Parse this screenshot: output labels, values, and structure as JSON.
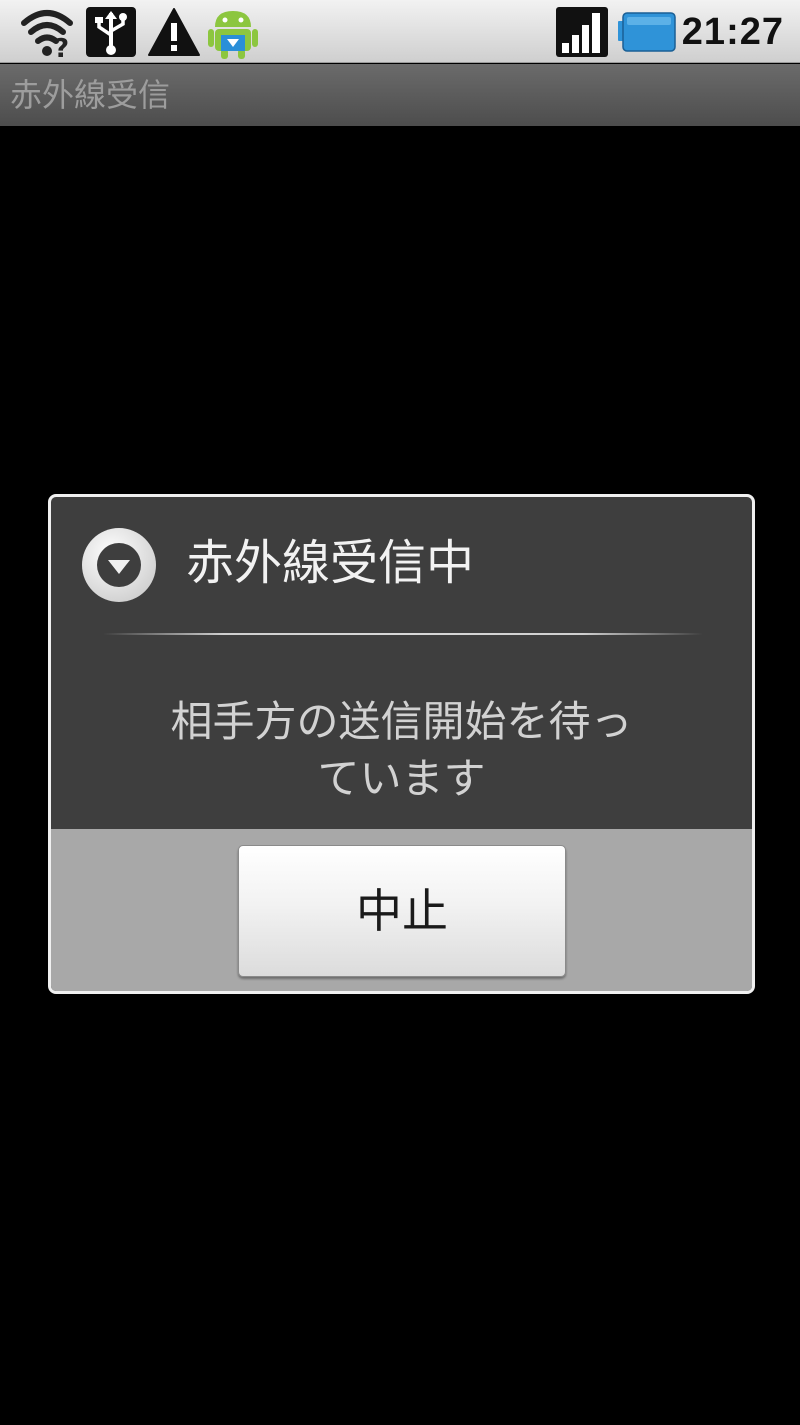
{
  "status_bar": {
    "left_icons": [
      "wifi-question-icon",
      "usb-icon",
      "warning-icon",
      "android-download-icon"
    ],
    "right_icons": [
      "signal-strength-icon",
      "battery-icon"
    ],
    "time": "21:27"
  },
  "title_bar": {
    "title": "赤外線受信"
  },
  "dialog": {
    "icon": "dropdown-circle-icon",
    "title": "赤外線受信中",
    "message": "相手方の送信開始を待っ\nています",
    "message_line1": "相手方の送信開始を待っ",
    "message_line2": "ています",
    "button_label": "中止"
  },
  "colors": {
    "background": "#000000",
    "dialog_body": "#3e3e3e",
    "dialog_footer": "#a8a8a8",
    "battery": "#2f93d8"
  }
}
